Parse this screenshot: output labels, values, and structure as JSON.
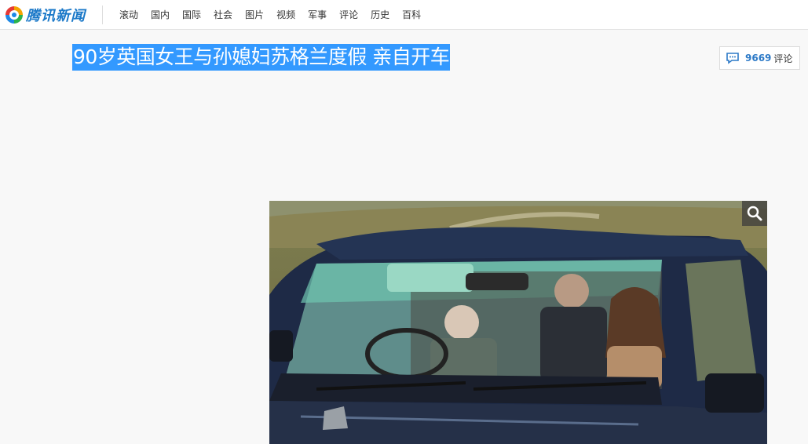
{
  "header": {
    "logo_text": "腾讯新闻",
    "nav": [
      "滚动",
      "国内",
      "国际",
      "社会",
      "图片",
      "视频",
      "军事",
      "评论",
      "历史",
      "百科"
    ]
  },
  "article": {
    "title": "90岁英国女王与孙媳妇苏格兰度假 亲自开车",
    "comment_count": "9669",
    "comment_label": "评论"
  },
  "icons": {
    "logo": "tencent-news-logo-icon",
    "comment": "comment-bubble-icon",
    "zoom": "magnifier-icon"
  },
  "colors": {
    "accent": "#3399ff",
    "link": "#2d7ac7",
    "logo_blue": "#1a78c8"
  }
}
